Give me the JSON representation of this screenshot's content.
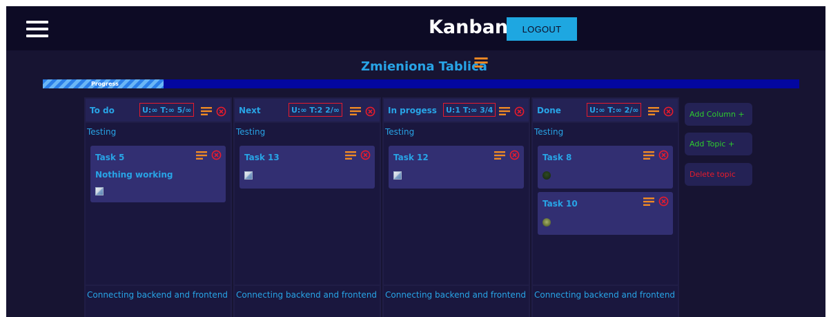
{
  "header": {
    "menu_icon": "hamburger-icon",
    "title": "Kanban",
    "logout_label": "LOGOUT"
  },
  "board": {
    "title": "Zmieniona Tablica",
    "menu_icon": "lines-menu-icon",
    "progress": {
      "label": "Progress",
      "fraction": 0.16
    }
  },
  "columns": [
    {
      "title": "To do",
      "limit": "U:∞ T:∞  5/∞",
      "topics": [
        {
          "label": "Testing",
          "tasks": [
            {
              "title": "Task 5",
              "description": "Nothing working",
              "attachment": "broken-image-icon"
            }
          ]
        },
        {
          "label": "Connecting backend and frontend"
        }
      ]
    },
    {
      "title": "Next",
      "limit": "U:∞  T:2  2/∞",
      "topics": [
        {
          "label": "Testing",
          "tasks": [
            {
              "title": "Task 13",
              "attachment": "broken-image-icon"
            }
          ]
        },
        {
          "label": "Connecting backend and frontend"
        }
      ]
    },
    {
      "title": "In progess",
      "limit": "U:1  T:∞  3/4",
      "topics": [
        {
          "label": "Testing",
          "tasks": [
            {
              "title": "Task 12",
              "attachment": "broken-image-icon"
            }
          ]
        },
        {
          "label": "Connecting backend and frontend"
        }
      ]
    },
    {
      "title": "Done",
      "limit": "U:∞  T:∞  2/∞",
      "topics": [
        {
          "label": "Testing",
          "tasks": [
            {
              "title": "Task 8",
              "attachment": "user-avatar"
            },
            {
              "title": "Task 10",
              "attachment": "user-avatar"
            }
          ]
        },
        {
          "label": "Connecting backend and frontend"
        }
      ]
    }
  ],
  "sidebar": {
    "add_column_label": "Add Column +",
    "add_topic_label": "Add Topic +",
    "delete_topic_label": "Delete topic"
  },
  "colors": {
    "background": "#171432",
    "header": "#0d0b25",
    "accent": "#28a4e6",
    "menu_icon": "#f08a24",
    "close_icon": "#e81b2c",
    "add_green": "#2ecc2e",
    "delete_red": "#e81b2c"
  }
}
